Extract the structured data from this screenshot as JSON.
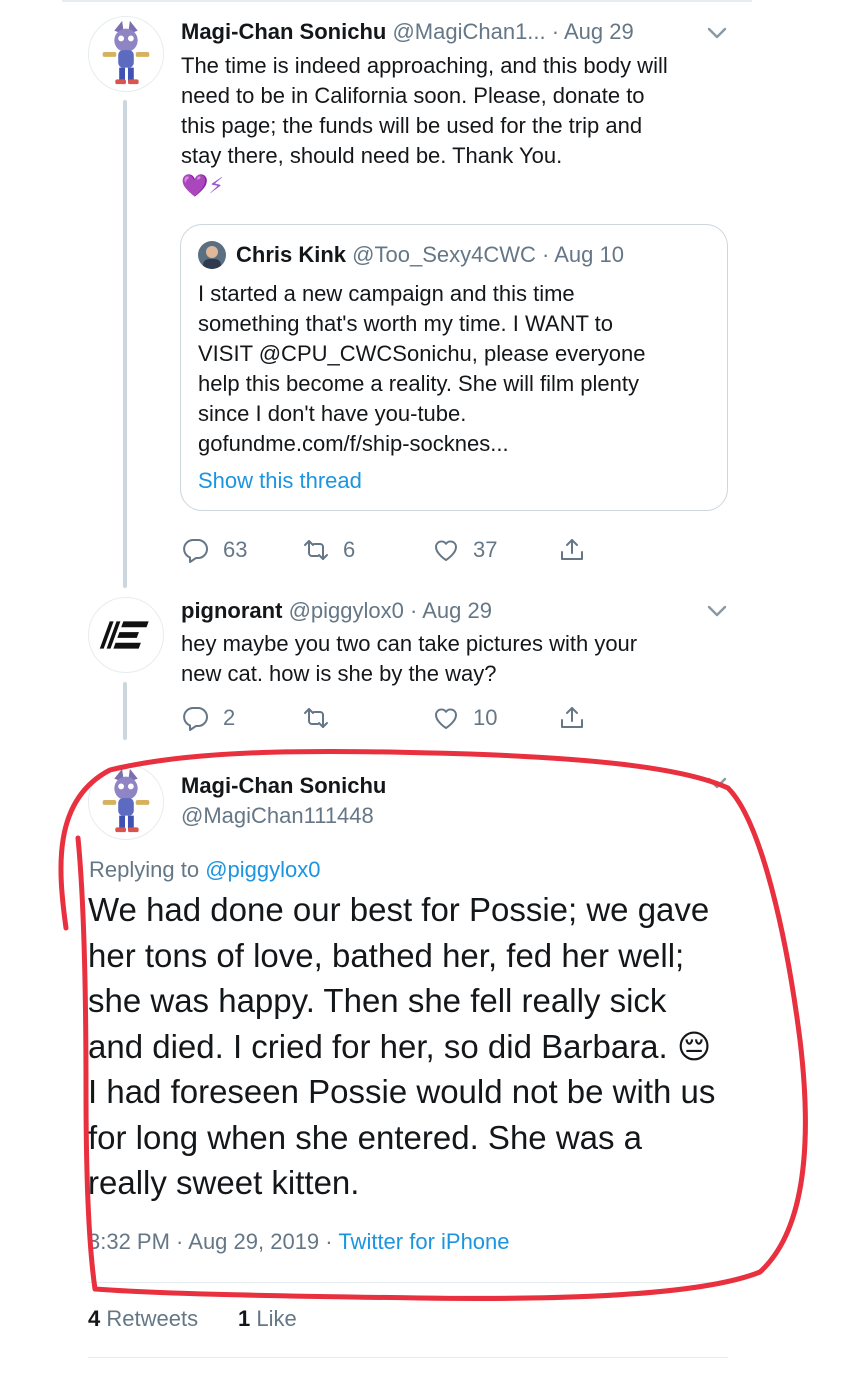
{
  "tweet1": {
    "name": "Magi-Chan Sonichu",
    "handle": "@MagiChan1...",
    "date": "· Aug 29",
    "lines": [
      "The time is indeed approaching, and this body will",
      "need to be in California soon. Please, donate to",
      "this page; the funds will be used for the trip and",
      "stay there, should need be. Thank You."
    ],
    "emoji": "💜⚡",
    "quote": {
      "name": "Chris Kink",
      "handle": "@Too_Sexy4CWC",
      "date": "· Aug 10",
      "lines": [
        "I started a new campaign and this time",
        "something that's worth my time. I WANT to",
        "VISIT @CPU_CWCSonichu, please everyone",
        "help this become a reality. She will film plenty",
        "since I don't have you-tube.",
        "gofundme.com/f/ship-socknes..."
      ],
      "show_thread": "Show this thread"
    },
    "actions": {
      "replies": "63",
      "retweets": "6",
      "likes": "37"
    }
  },
  "tweet2": {
    "name": "pignorant",
    "handle": "@piggylox0",
    "date": "· Aug 29",
    "lines": [
      "hey maybe you two can take pictures with your",
      "new cat. how is she by the way?"
    ],
    "actions": {
      "replies": "2",
      "retweets": "",
      "likes": "10"
    }
  },
  "main": {
    "name": "Magi-Chan Sonichu",
    "handle": "@MagiChan111448",
    "replying_prefix": "Replying to",
    "replying_handle": "@piggylox0",
    "lines": [
      "We had done our best for Possie; we gave",
      "her tons of love, bathed her, fed her well;",
      "she was happy. Then she fell really sick",
      "and died. I cried for her, so did Barbara. 😔",
      "I had foreseen Possie would not be with us",
      "for long when she entered. She was a",
      "really sweet kitten."
    ],
    "timestamp": "3:32 PM · Aug 29, 2019 · ",
    "source": "Twitter for iPhone",
    "retweets_count": "4",
    "retweets_label": "Retweets",
    "likes_count": "1",
    "likes_label": "Like"
  },
  "colors": {
    "link": "#1b95e0",
    "secondary_text": "#657786",
    "annotation": "#e8303e",
    "thread_line": "#ccd6dd"
  },
  "icons": [
    "reply-icon",
    "retweet-icon",
    "like-icon",
    "share-icon",
    "chevron-down-icon"
  ]
}
